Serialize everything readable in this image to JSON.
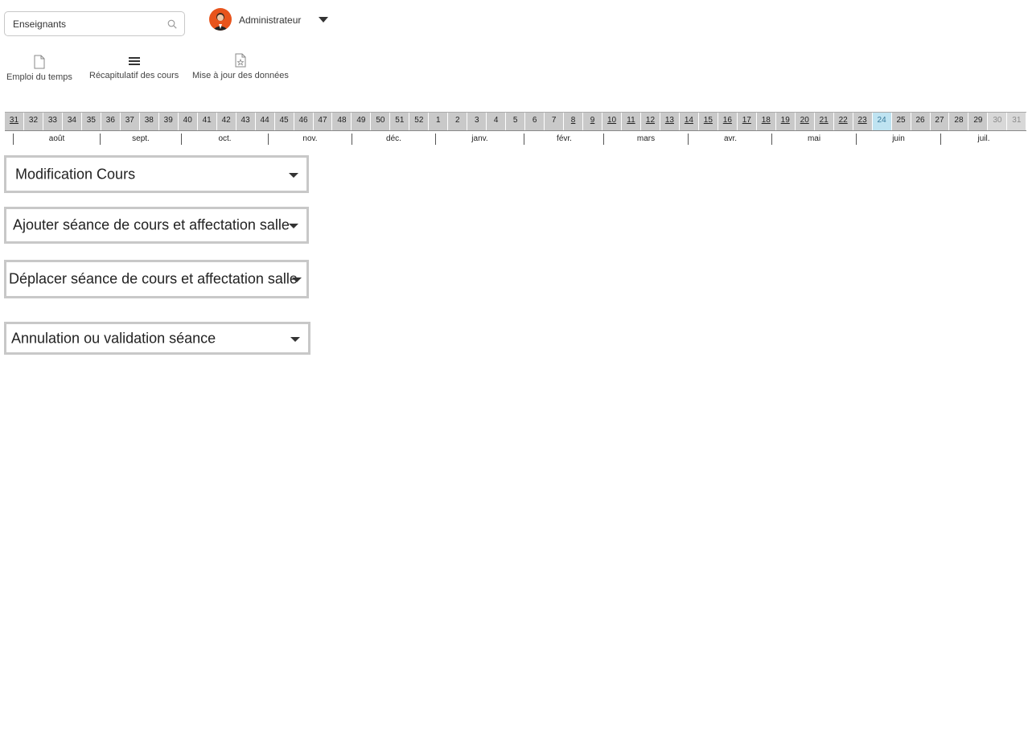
{
  "search": {
    "value": "Enseignants"
  },
  "user": {
    "name": "Administrateur"
  },
  "toolbar": {
    "items": [
      {
        "label": "Emploi du temps",
        "icon": "document-icon"
      },
      {
        "label": "Récapitulatif des cours",
        "icon": "list-icon"
      },
      {
        "label": "Mise à jour des données",
        "icon": "document-star-icon"
      }
    ]
  },
  "weeks": [
    "31",
    "32",
    "33",
    "34",
    "35",
    "36",
    "37",
    "38",
    "39",
    "40",
    "41",
    "42",
    "43",
    "44",
    "45",
    "46",
    "47",
    "48",
    "49",
    "50",
    "51",
    "52",
    "1",
    "2",
    "3",
    "4",
    "5",
    "6",
    "7",
    "8",
    "9",
    "10",
    "11",
    "12",
    "13",
    "14",
    "15",
    "16",
    "17",
    "18",
    "19",
    "20",
    "21",
    "22",
    "23",
    "24",
    "25",
    "26",
    "27",
    "28",
    "29",
    "30",
    "31"
  ],
  "current_week": "24",
  "months": [
    "août",
    "sept.",
    "oct.",
    "nov.",
    "déc.",
    "janv.",
    "févr.",
    "mars",
    "avr.",
    "mai",
    "juin",
    "juil."
  ],
  "panels": [
    {
      "label": "Modification Cours"
    },
    {
      "label": "Ajouter séance de cours et affectation salle"
    },
    {
      "label": "Déplacer séance de cours et affectation salle"
    },
    {
      "label": "Annulation ou validation séance"
    }
  ],
  "colors": {
    "avatar": "#e8541c",
    "current_week": "#bfe3f1",
    "panel_border": "#c8c8c8"
  }
}
